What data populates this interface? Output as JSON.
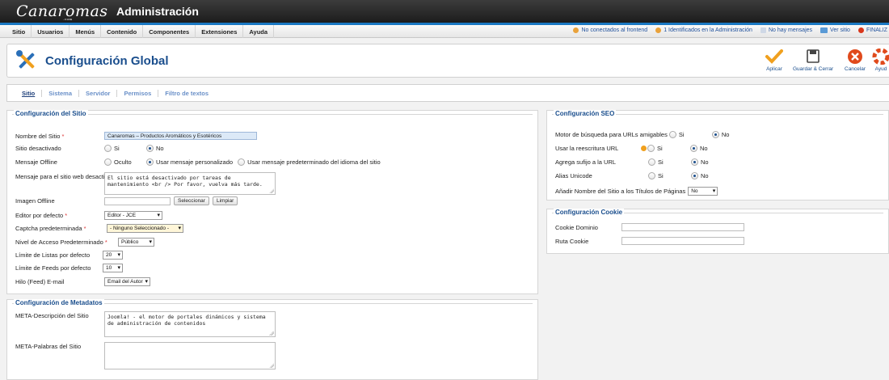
{
  "header": {
    "logo_text": "Canaromas",
    "logo_small": ".com",
    "title": "Administración"
  },
  "menu": [
    "Sitio",
    "Usuarios",
    "Menús",
    "Contenido",
    "Componentes",
    "Extensiones",
    "Ayuda"
  ],
  "status": {
    "frontend": "No conectados al frontend",
    "admin": "1 Identificados en la Administración",
    "messages": "No hay mensajes",
    "view_site": "Ver sitio",
    "logout": "FINALIZ"
  },
  "toolbar": {
    "title": "Configuración Global",
    "apply": "Aplicar",
    "save_close": "Guardar & Cerrar",
    "cancel": "Cancelar",
    "help": "Ayud"
  },
  "tabs": [
    "Sitio",
    "Sistema",
    "Servidor",
    "Permisos",
    "Filtro de textos"
  ],
  "site": {
    "legend": "Configuración del Sitio",
    "name_label": "Nombre del Sitio",
    "name_value": "Canaromas – Productos Aromáticos y Esotéricos",
    "offline_label": "Sitio desactivado",
    "yes": "Si",
    "no": "No",
    "offline_msg_label": "Mensaje Offline",
    "opt_hidden": "Oculto",
    "opt_custom": "Usar mensaje personalizado",
    "opt_default": "Usar mensaje predeterminado del idioma del sitio",
    "custom_msg_label": "Mensaje para el sitio web desactivado",
    "custom_msg_value": "El sitio está desactivado por tareas de\nmantenimiento <br /> Por favor, vuelva más tarde.",
    "offline_image_label": "Imagen Offline",
    "select_btn": "Seleccionar",
    "clear_btn": "Limpiar",
    "editor_label": "Editor por defecto",
    "editor_value": "Editor - JCE",
    "captcha_label": "Captcha predeterminada",
    "captcha_value": "- Ninguno Seleccionado -",
    "access_label": "Nivel de Acceso Predeterminado",
    "access_value": "Público",
    "list_limit_label": "Límite de Listas por defecto",
    "list_limit_value": "20",
    "feed_limit_label": "Límite de Feeds por defecto",
    "feed_limit_value": "10",
    "feed_email_label": "Hilo (Feed) E-mail",
    "feed_email_value": "Email del Autor"
  },
  "metadata": {
    "legend": "Configuración de Metadatos",
    "desc_label": "META-Descripción del Sitio",
    "desc_value": "Joomla! - el motor de portales dinámicos y sistema\nde administración de contenidos",
    "keywords_label": "META-Palabras del Sitio",
    "keywords_value": ""
  },
  "seo": {
    "legend": "Configuración SEO",
    "sef_label": "Motor de búsqueda para URLs amigables",
    "rewrite_label": "Usar la reescritura URL",
    "suffix_label": "Agrega sufijo a la URL",
    "unicode_label": "Alias Unicode",
    "sitename_label": "Añadir Nombre del Sitio a los Títulos de Páginas",
    "sitename_value": "No",
    "yes": "Si",
    "no": "No"
  },
  "cookie": {
    "legend": "Configuración Cookie",
    "domain_label": "Cookie Dominio",
    "path_label": "Ruta Cookie"
  },
  "colors": {
    "accent": "#1a4e8d",
    "header_bar": "#1a78c2",
    "apply": "#f0a01e",
    "cancel": "#e04a1c"
  }
}
